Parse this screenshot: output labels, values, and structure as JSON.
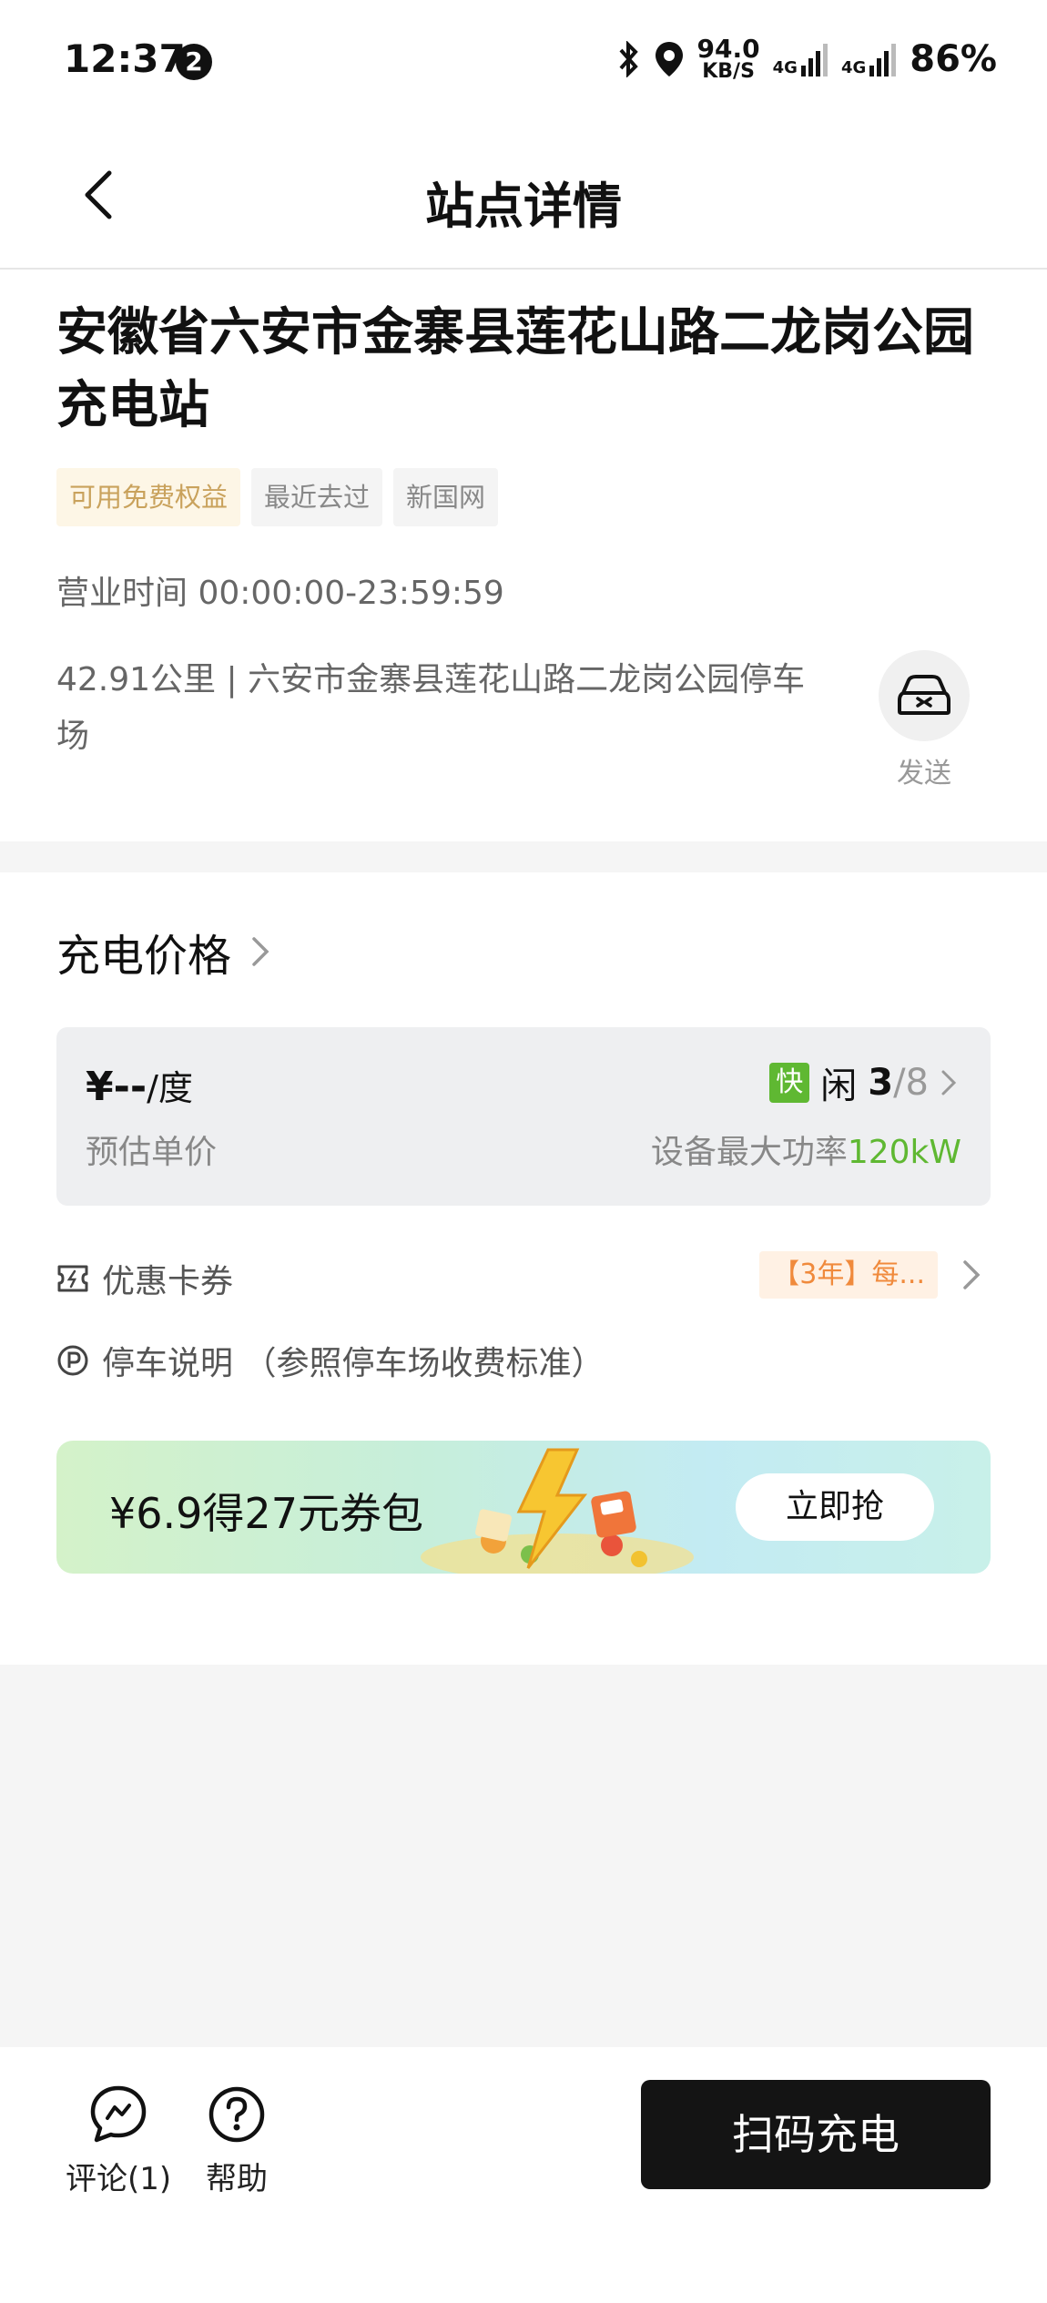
{
  "status_bar": {
    "time": "12:37",
    "notification_count": "2",
    "net_speed_value": "94.0",
    "net_speed_unit": "KB/S",
    "signal1": "4G",
    "signal2": "4G",
    "battery": "86%"
  },
  "header": {
    "title": "站点详情"
  },
  "station": {
    "name": "安徽省六安市金寨县莲花山路二龙岗公园充电站",
    "tags": [
      "可用免费权益",
      "最近去过",
      "新国网"
    ],
    "hours": "营业时间 00:00:00-23:59:59",
    "address": "42.91公里 | 六安市金寨县莲花山路二龙岗公园停车场",
    "send_label": "发送"
  },
  "price": {
    "section_title": "充电价格",
    "price_value": "¥--",
    "price_unit": "/度",
    "price_caption": "预估单价",
    "fast_badge": "快",
    "idle_label": "闲",
    "idle_count": "3",
    "total_count": "/8",
    "power_label": "设备最大功率",
    "power_value": "120kW"
  },
  "coupons": {
    "label": "优惠卡券",
    "promo": "【3年】每..."
  },
  "parking": {
    "label": "停车说明 （参照停车场收费标准）"
  },
  "banner": {
    "text": "¥6.9得27元券包",
    "button": "立即抢"
  },
  "bottom_bar": {
    "comment_label": "评论(1)",
    "help_label": "帮助",
    "scan_button": "扫码充电"
  },
  "colors": {
    "accent_green": "#5fb832",
    "coupon_orange": "#f08a3c",
    "tag_gold": "#c9a25c",
    "primary_button": "#141414"
  }
}
